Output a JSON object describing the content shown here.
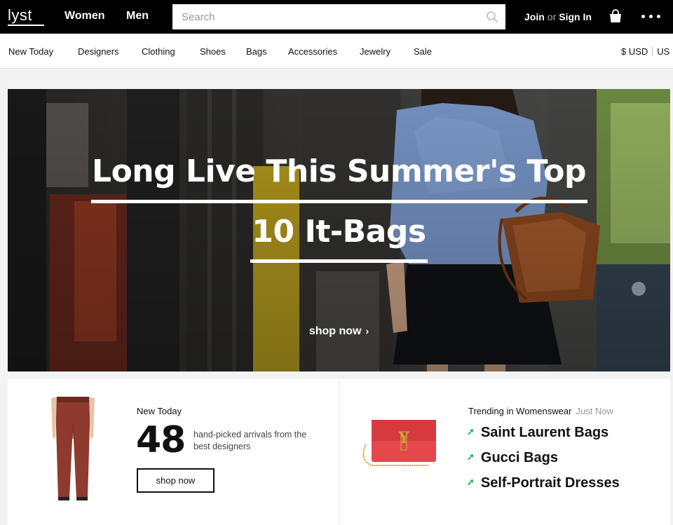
{
  "header": {
    "logo": "lyst",
    "nav": {
      "women": "Women",
      "men": "Men"
    },
    "search": {
      "placeholder": "Search",
      "value": ""
    },
    "auth": {
      "join": "Join",
      "or": "or",
      "sign_in": "Sign In"
    },
    "icons": {
      "search": "search-icon",
      "bag": "shopping-bag-icon",
      "more": "more-icon"
    }
  },
  "categories": [
    "New Today",
    "Designers",
    "Clothing",
    "Shoes",
    "Bags",
    "Accessories",
    "Jewelry",
    "Sale"
  ],
  "currency": {
    "symbol_code": "$ USD",
    "region": "US"
  },
  "hero": {
    "title_line1": "Long Live This Summer's Top",
    "title_line2": "10 It-Bags",
    "cta": "shop now",
    "cta_chevron": "›"
  },
  "new_today": {
    "label": "New Today",
    "count": "48",
    "description": "hand-picked arrivals from the best designers",
    "button": "shop now"
  },
  "trending": {
    "label": "Trending in Womenswear",
    "time": "Just Now",
    "arrow": "➚",
    "items": [
      "Saint Laurent Bags",
      "Gucci Bags",
      "Self-Portrait Dresses"
    ]
  },
  "colors": {
    "topbar": "#000000",
    "trend_arrow": "#2bb24c",
    "bag_red": "#e5474b",
    "pants_rust": "#8e3a2e"
  }
}
